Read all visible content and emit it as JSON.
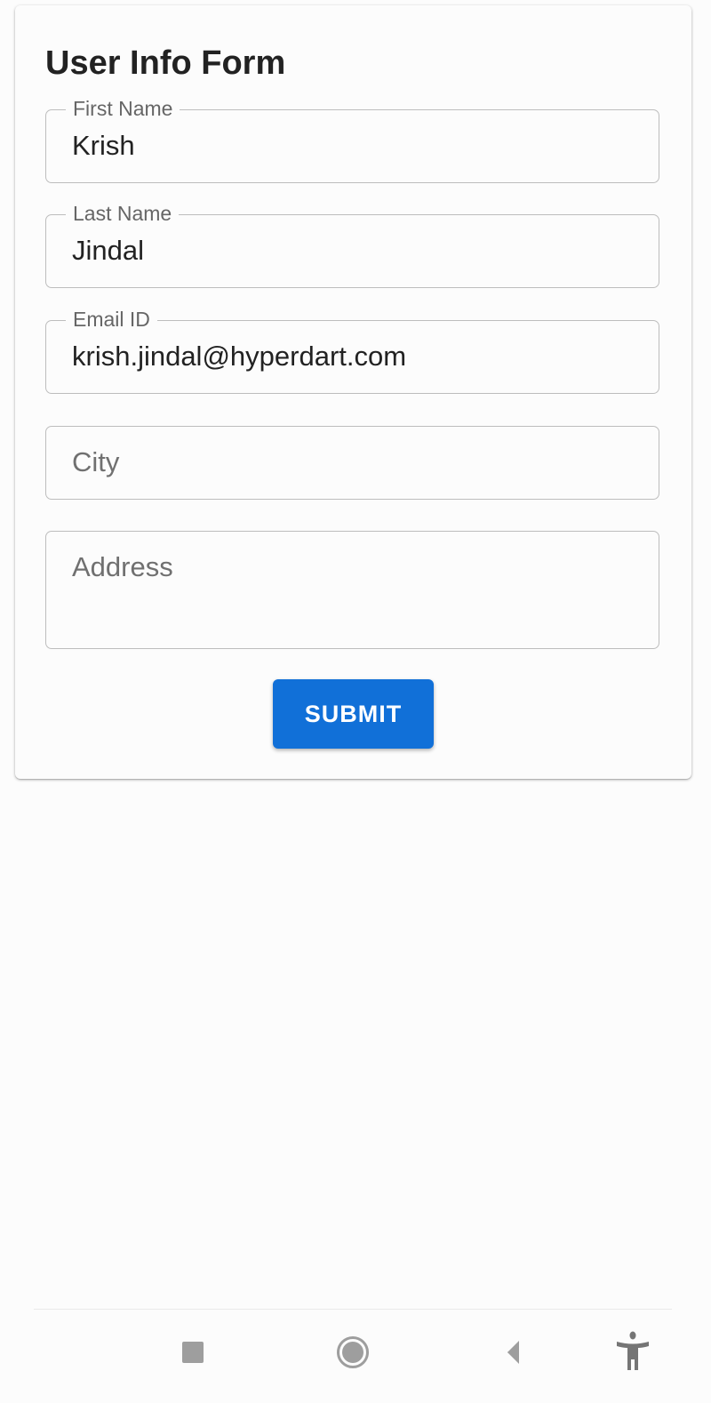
{
  "form": {
    "title": "User Info Form",
    "fields": [
      {
        "label": "First Name",
        "value": "Krish"
      },
      {
        "label": "Last Name",
        "value": "Jindal"
      },
      {
        "label": "Email ID",
        "value": "krish.jindal@hyperdart.com"
      },
      {
        "placeholder": "City",
        "value": ""
      },
      {
        "placeholder": "Address",
        "value": ""
      }
    ],
    "submit_label": "SUBMIT",
    "accent_color": "#1170d8"
  },
  "nav_bar": {
    "icons": [
      "recents-square-icon",
      "home-circle-icon",
      "back-triangle-icon",
      "accessibility-icon"
    ]
  }
}
